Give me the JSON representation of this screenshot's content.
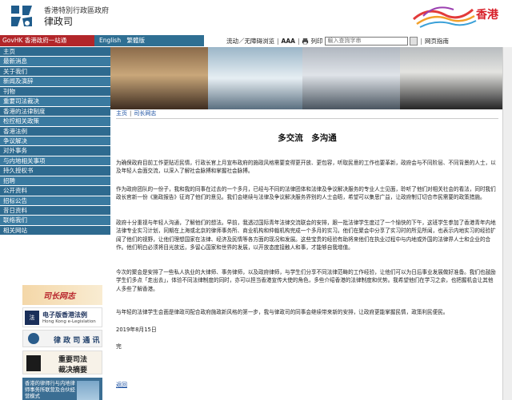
{
  "header": {
    "gov_title": "香港特別行政區政府",
    "dept_title": "律政司",
    "brand_text": "香港"
  },
  "topbar": {
    "govhk": "GovHK 香港政府一站通",
    "lang_en": "English",
    "lang_sc": "繁體版",
    "mobile": "流动／无障碍浏览",
    "font_size": "AAA",
    "print": "列印",
    "site_map": "网页指南",
    "search_placeholder": "輸入查詢字串"
  },
  "sidebar": {
    "items": [
      {
        "label": "主页"
      },
      {
        "label": "最新消息"
      },
      {
        "label": "关于我们"
      },
      {
        "label": "新闻及演辞"
      },
      {
        "label": "刊物"
      },
      {
        "label": "重要司法裁决"
      },
      {
        "label": "香港的法律制度"
      },
      {
        "label": "检控相关政策"
      },
      {
        "label": "香港法例"
      },
      {
        "label": "争议解决"
      },
      {
        "label": "对外事务"
      },
      {
        "label": "与内地相关事项"
      },
      {
        "label": "持久授权书"
      },
      {
        "label": "招聘"
      },
      {
        "label": "公开资料"
      },
      {
        "label": "招标公告"
      },
      {
        "label": "昔日资料"
      },
      {
        "label": "联络我们"
      },
      {
        "label": "相关网站"
      }
    ],
    "banner_column": "司长网志",
    "banner_elegis_title": "电子版香港法例",
    "banner_elegis_sub": "Hong Kong e-Legislation",
    "banner_lawmag": "律 政 司 通 讯",
    "banner_judgment_line1": "重要司法",
    "banner_judgment_line2": "裁决摘要",
    "banner_legal_text": "香港的律师行与内地律师事务所联营及合伙经营模式"
  },
  "content": {
    "breadcrumb": [
      "主页",
      "司长网志"
    ],
    "title": "多交流　多沟通",
    "paragraphs": [
      "为确保政府目前工作更贴近民情，行政长官上月宣布政府的施政风格需要变得更开放、更包容，听取民意的工作也要革新，政府会与不同阶层、不同背景的人士，以及年轻人会面交流，以深入了解社会脉搏和掌握社会脉搏。",
      "作为政府团队的一份子，我和我的同事在过去的一个多月，已经与不同的法律团体和法律及争议解决服务的专业人士见面，聆听了他们对相关社会的看法，同时我们政长官新一份《施政报告》征询了他们的意见。我们会继续与法律及争议解决服务界别的人士会晤，希望可以集思广益，让政府制订切合市民需要的政策措施。",
      "政府十分重视与年轻人沟通，了解他们的想法。早前，我透过国际青年法律交流联会的安排，跟一批法律学生度过了一个愉快的下午，这班学生参加了香港青年内地法律专业实习计划，同期在上海或北京的律师事务所、商业机构和仲裁机构完成一个多月的实习。他们在聚会中分享了实习时的所见所闻，也表示内地实习的经验扩阔了他们的视野，让他们理想国家在法律、经济及民情等各方面的现况和发展。这些宝贵的经验有助将来他们在执业过程中与内地或外国的法律界人士和企业的合作。他们明白必须将目光放远，多留心国家和世界的发展，以开放态度接触人和事，才能够自我增值。",
      "今次的聚会是安排了一些私人执业的大律师、事务律师，以及政府律师，与学生们分享不同法律范畴的工作经验，让他们可以为日后事业发展做好准备。我们也鼓励学生们多点「走出去」，体验不同法律制度的同时，亦可以担当香港宣传大使的角色，多些介绍香港的法律制度和优势。我希望他们在学习之余，也把握机会让其他人多些了解香港。",
      "与年轻的法律学生会面是律政司配合政府施政新风格的第一步，我与律政司的同事会继续带来新的安排，让政府更能掌握民情，政策利民便民。"
    ],
    "date": "2019年8月15日",
    "end": "完",
    "back": "返回"
  }
}
